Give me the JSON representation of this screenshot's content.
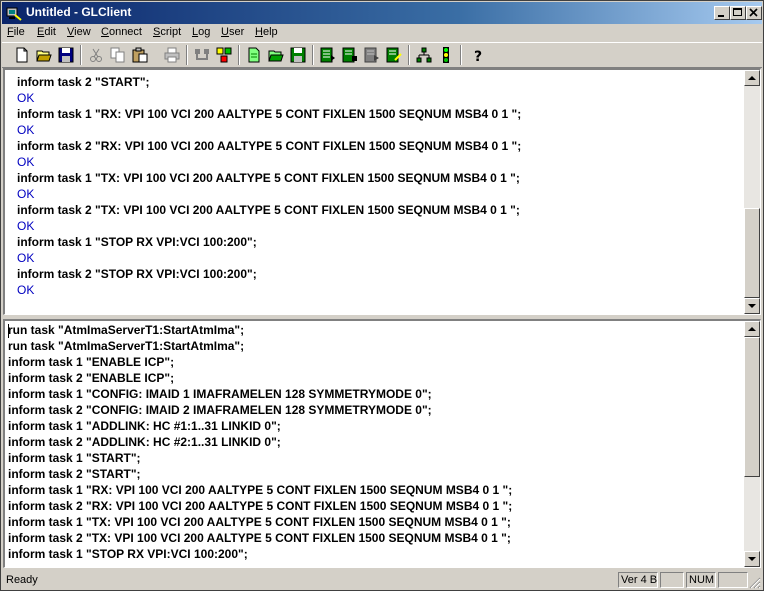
{
  "window": {
    "title": "Untitled - GLClient"
  },
  "menu": [
    {
      "label": "File",
      "u": "F",
      "rest": "ile"
    },
    {
      "label": "Edit",
      "u": "E",
      "rest": "dit"
    },
    {
      "label": "View",
      "u": "V",
      "rest": "iew"
    },
    {
      "label": "Connect",
      "u": "C",
      "rest": "onnect"
    },
    {
      "label": "Script",
      "u": "S",
      "rest": "cript"
    },
    {
      "label": "Log",
      "u": "L",
      "rest": "og"
    },
    {
      "label": "User",
      "u": "U",
      "rest": "ser"
    },
    {
      "label": "Help",
      "u": "H",
      "rest": "elp"
    }
  ],
  "toolbar": {
    "icons": [
      "new-file-icon",
      "open-folder-icon",
      "save-icon",
      "cut-icon",
      "copy-icon",
      "paste-icon",
      "print-icon",
      "connect-icon",
      "disconnect-icon",
      "new-script-icon",
      "open-script-icon",
      "save-script-icon",
      "run-script-icon",
      "step-script-icon",
      "stop-script-icon",
      "edit-script-icon",
      "tree-view-icon",
      "traffic-light-icon",
      "help-icon"
    ]
  },
  "output_pane": {
    "lines": [
      {
        "text": "inform task 2 \"START\";",
        "type": "cmd"
      },
      {
        "text": "OK",
        "type": "ok"
      },
      {
        "text": "inform task 1 \"RX: VPI 100 VCI 200 AALTYPE 5 CONT FIXLEN 1500 SEQNUM MSB4 0 1 \";",
        "type": "cmd"
      },
      {
        "text": "OK",
        "type": "ok"
      },
      {
        "text": "inform task 2 \"RX: VPI 100 VCI 200 AALTYPE 5 CONT FIXLEN 1500 SEQNUM MSB4 0 1 \";",
        "type": "cmd"
      },
      {
        "text": "OK",
        "type": "ok"
      },
      {
        "text": "inform task 1 \"TX: VPI 100 VCI 200 AALTYPE 5 CONT FIXLEN 1500 SEQNUM MSB4 0 1 \";",
        "type": "cmd"
      },
      {
        "text": "OK",
        "type": "ok"
      },
      {
        "text": "inform task 2 \"TX: VPI 100 VCI 200 AALTYPE 5 CONT FIXLEN 1500 SEQNUM MSB4 0 1 \";",
        "type": "cmd"
      },
      {
        "text": "OK",
        "type": "ok"
      },
      {
        "text": "inform task 1 \"STOP RX VPI:VCI 100:200\";",
        "type": "cmd"
      },
      {
        "text": "OK",
        "type": "ok"
      },
      {
        "text": "inform task 2 \"STOP RX VPI:VCI 100:200\";",
        "type": "cmd"
      },
      {
        "text": "OK",
        "type": "ok"
      }
    ]
  },
  "script_pane": {
    "lines": [
      "run task \"AtmImaServerT1:StartAtmIma\";",
      "run task \"AtmImaServerT1:StartAtmIma\";",
      "inform task 1 \"ENABLE ICP\";",
      "inform task 2 \"ENABLE ICP\";",
      "inform task 1 \"CONFIG: IMAID 1 IMAFRAMELEN 128 SYMMETRYMODE 0\";",
      "inform task 2 \"CONFIG: IMAID 2 IMAFRAMELEN 128 SYMMETRYMODE 0\";",
      "inform task 1 \"ADDLINK: HC #1:1..31 LINKID 0\";",
      "inform task 2 \"ADDLINK: HC #2:1..31 LINKID 0\";",
      "inform task 1 \"START\";",
      "inform task 2 \"START\";",
      "inform task 1 \"RX: VPI 100 VCI 200 AALTYPE 5 CONT FIXLEN 1500 SEQNUM MSB4 0 1 \";",
      "inform task 2 \"RX: VPI 100 VCI 200 AALTYPE 5 CONT FIXLEN 1500 SEQNUM MSB4 0 1 \";",
      "inform task 1 \"TX: VPI 100 VCI 200 AALTYPE 5 CONT FIXLEN 1500 SEQNUM MSB4 0 1 \";",
      "inform task 2 \"TX: VPI 100 VCI 200 AALTYPE 5 CONT FIXLEN 1500 SEQNUM MSB4 0 1 \";",
      "inform task 1 \"STOP RX VPI:VCI 100:200\";"
    ]
  },
  "status": {
    "text": "Ready",
    "version": "Ver 4 B",
    "indicator": "",
    "num": "NUM",
    "extra": ""
  },
  "colors": {
    "ok": "#0000c0",
    "title_start": "#0a246a",
    "title_end": "#a6caf0"
  }
}
